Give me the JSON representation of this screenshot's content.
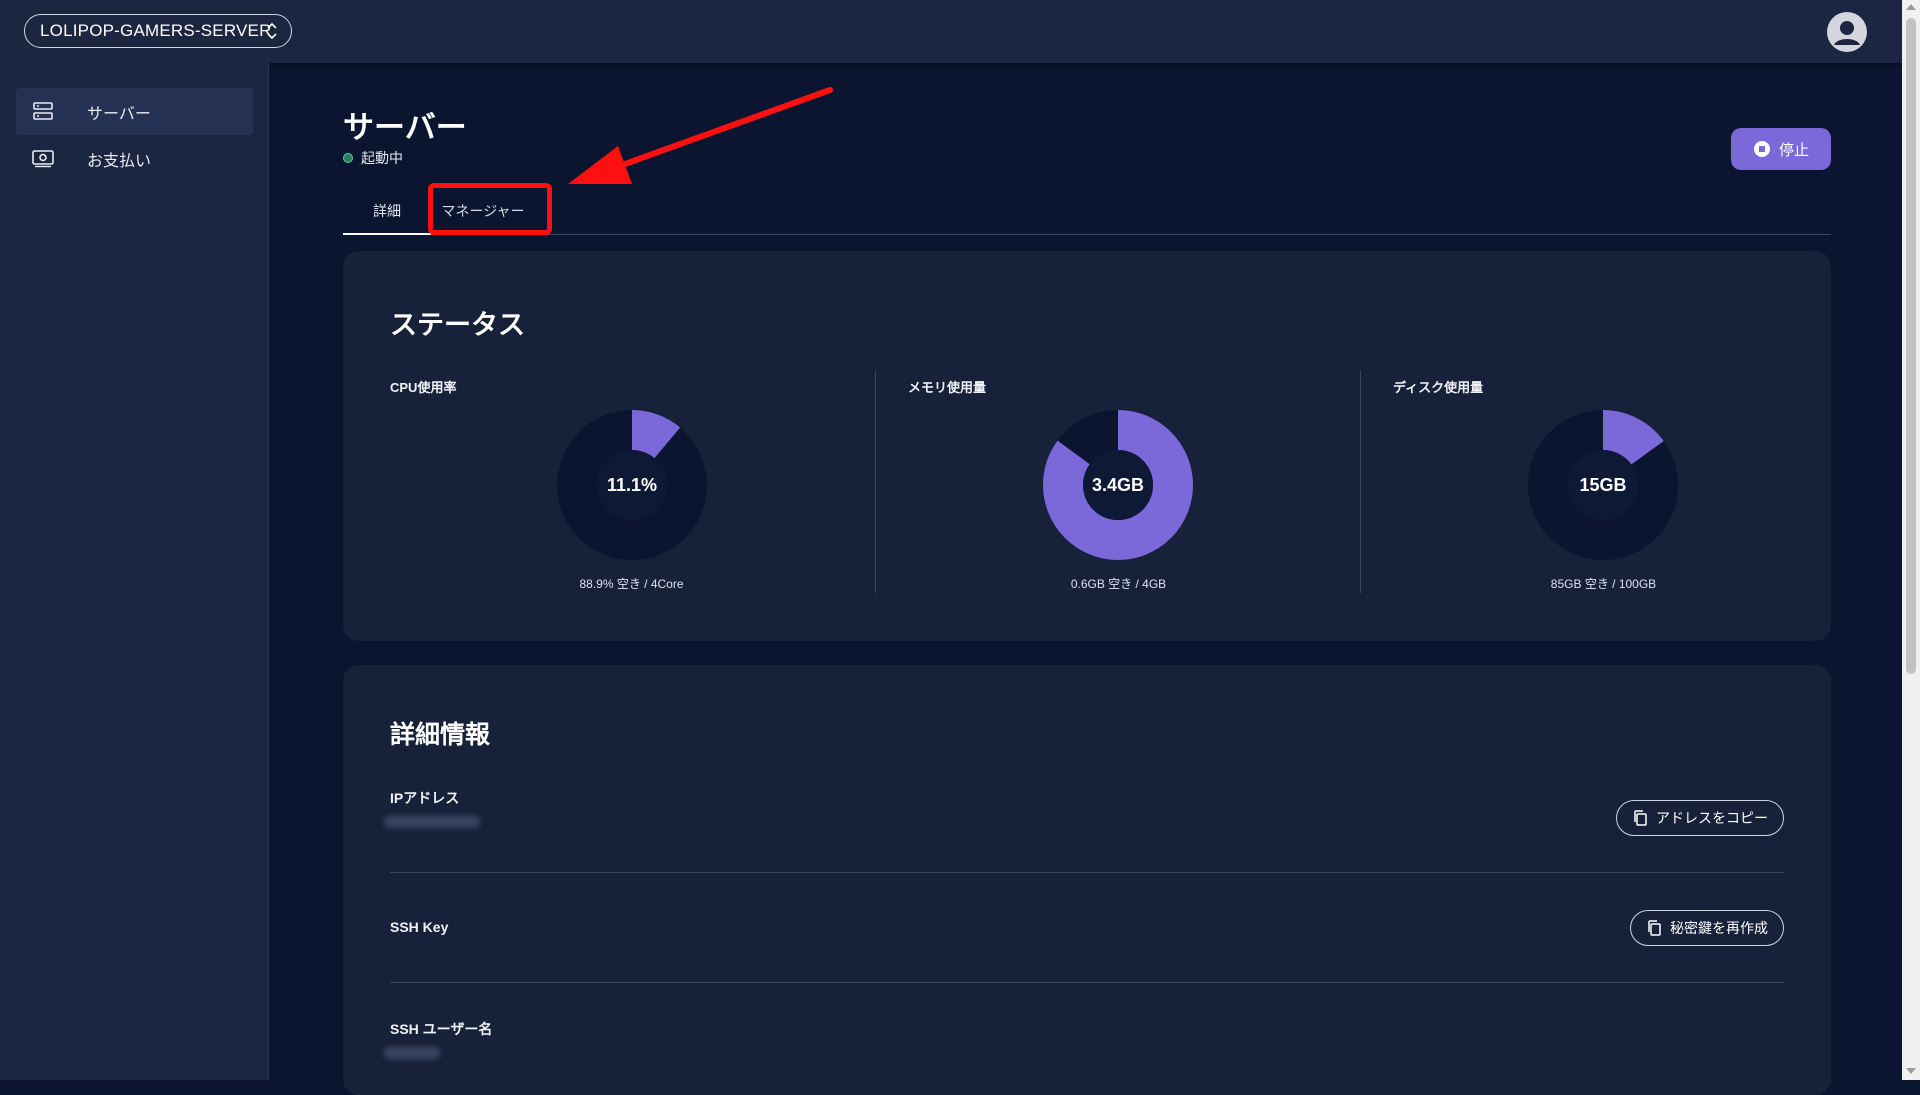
{
  "topbar": {
    "server_name": "LOLIPOP-GAMERS-SERVER"
  },
  "sidebar": {
    "items": [
      {
        "label": "サーバー",
        "icon": "server-icon",
        "active": true
      },
      {
        "label": "お支払い",
        "icon": "payment-icon",
        "active": false
      }
    ]
  },
  "header": {
    "title": "サーバー",
    "status": "起動中",
    "stop_label": "停止"
  },
  "tabs": [
    {
      "label": "詳細",
      "active": true
    },
    {
      "label": "マネージャー",
      "active": false
    }
  ],
  "status_card": {
    "title": "ステータス",
    "metrics": [
      {
        "label": "CPU使用率",
        "center": "11.1%",
        "footer": "88.9% 空き / 4Core",
        "used_fraction": 0.111
      },
      {
        "label": "メモリ使用量",
        "center": "3.4GB",
        "footer": "0.6GB 空き / 4GB",
        "used_fraction": 0.85
      },
      {
        "label": "ディスク使用量",
        "center": "15GB",
        "footer": "85GB 空き / 100GB",
        "used_fraction": 0.15
      }
    ]
  },
  "details_card": {
    "title": "詳細情報",
    "ip_label": "IPアドレス",
    "copy_address_label": "アドレスをコピー",
    "ssh_key_label": "SSH Key",
    "regen_key_label": "秘密鍵を再作成",
    "ssh_user_label": "SSH ユーザー名"
  },
  "colors": {
    "accent": "#7b68d9",
    "donut_track": "#0b1530",
    "card_bg": "#172139",
    "highlight": "#ff1010",
    "status_running": "#5fc79b"
  }
}
